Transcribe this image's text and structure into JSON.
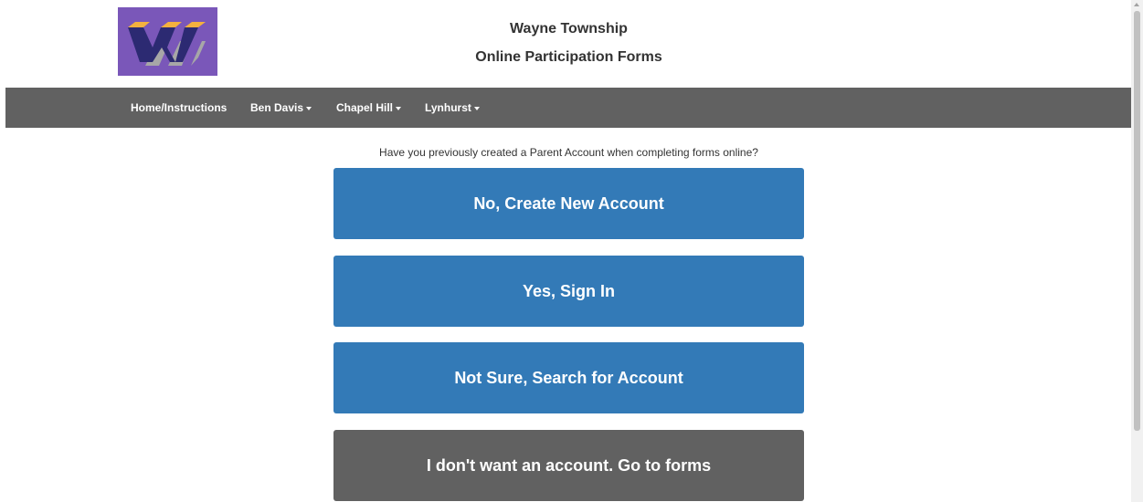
{
  "header": {
    "logo_name": "wayne-township-logo",
    "title": "Wayne Township",
    "subtitle": "Online Participation Forms"
  },
  "nav": {
    "home": "Home/Instructions",
    "ben_davis": "Ben Davis",
    "chapel_hill": "Chapel Hill",
    "lynhurst": "Lynhurst"
  },
  "main": {
    "question": "Have you previously created a Parent Account when completing forms online?",
    "buttons": {
      "create": "No, Create New Account",
      "sign_in": "Yes, Sign In",
      "search": "Not Sure, Search for Account",
      "no_account": "I don't want an account. Go to forms"
    }
  },
  "colors": {
    "navbar_bg": "#616161",
    "primary_button": "#337ab7",
    "secondary_button": "#616161",
    "logo_bg": "#7a57b9",
    "logo_yellow": "#f4b13e",
    "logo_navy": "#2c2a72",
    "logo_gray": "#a7a7a7"
  }
}
